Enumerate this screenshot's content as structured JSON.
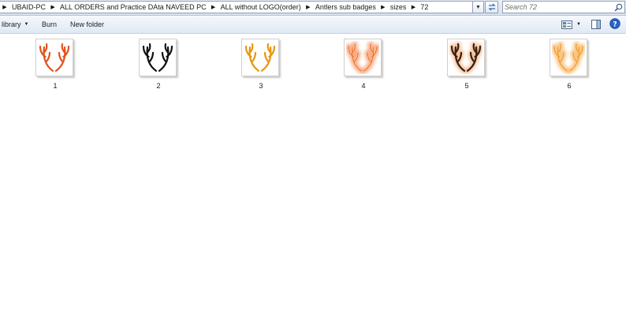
{
  "address_bar": {
    "breadcrumbs": [
      "UBAID-PC",
      "ALL ORDERS and Practice DAta NAVEED PC",
      "ALL without LOGO(order)",
      "Antlers sub badges",
      "sizes",
      "72"
    ],
    "search_placeholder": "Search 72"
  },
  "toolbar": {
    "library_label": "library",
    "burn_label": "Burn",
    "new_folder_label": "New folder"
  },
  "files": [
    {
      "name": "1",
      "style": "solid",
      "color": "#e2531b"
    },
    {
      "name": "2",
      "style": "solid",
      "color": "#111111"
    },
    {
      "name": "3",
      "style": "solid",
      "color": "#e8960e"
    },
    {
      "name": "4",
      "style": "glow",
      "color": "#f06a2a"
    },
    {
      "name": "5",
      "style": "glow-dark",
      "color": "#3a1e10"
    },
    {
      "name": "6",
      "style": "glow",
      "color": "#f3951c"
    }
  ],
  "colors": {
    "toolbar_top": "#f6f9fd",
    "toolbar_bottom": "#dfe8f4",
    "help_blue": "#2a62c9"
  }
}
